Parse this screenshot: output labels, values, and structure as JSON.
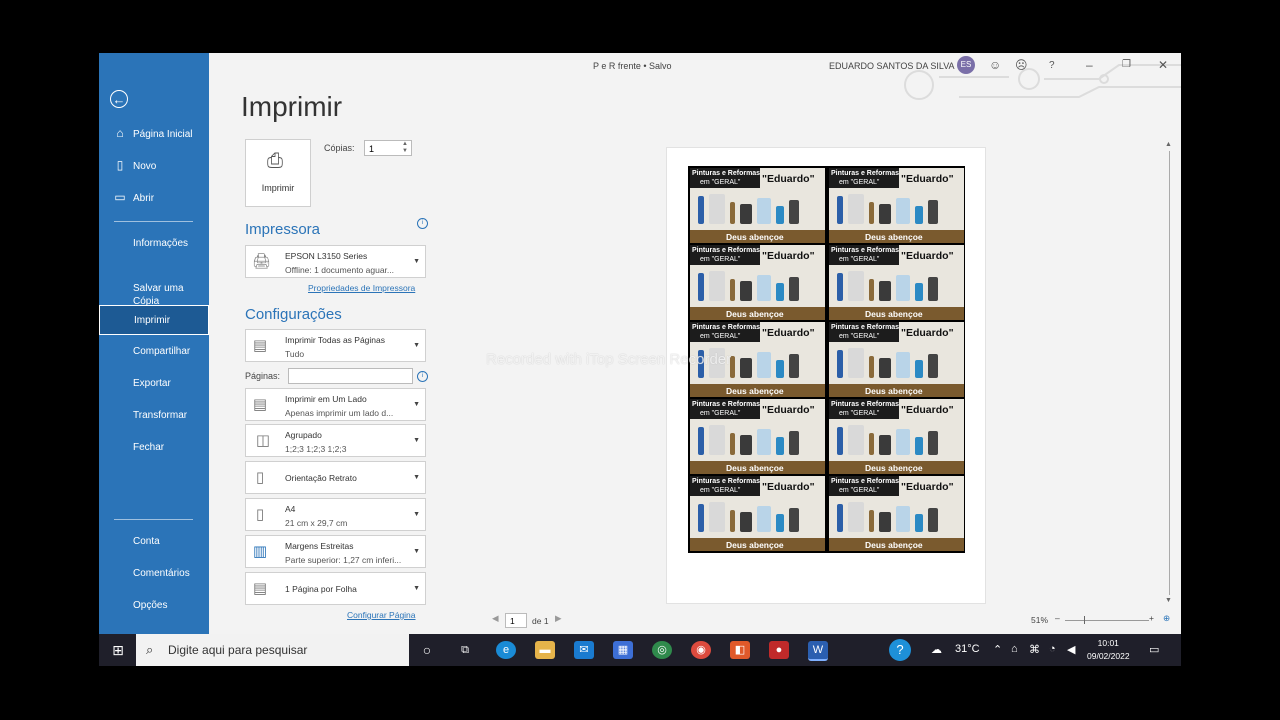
{
  "window": {
    "doc_title": "P e R  frente • Salvo",
    "user": "EDUARDO SANTOS DA SILVA",
    "avatar_initials": "ES"
  },
  "sidebar": {
    "items": [
      {
        "label": "Página Inicial",
        "icon": "home-icon"
      },
      {
        "label": "Novo",
        "icon": "new-document-icon"
      },
      {
        "label": "Abrir",
        "icon": "folder-open-icon"
      },
      {
        "label": "Informações"
      },
      {
        "label": "Salvar uma\nCópia"
      },
      {
        "label": "Imprimir"
      },
      {
        "label": "Compartilhar"
      },
      {
        "label": "Exportar"
      },
      {
        "label": "Transformar"
      },
      {
        "label": "Fechar"
      },
      {
        "label": "Conta"
      },
      {
        "label": "Comentários"
      },
      {
        "label": "Opções"
      }
    ]
  },
  "print": {
    "title": "Imprimir",
    "print_button": "Imprimir",
    "copies_label": "Cópias:",
    "copies_value": "1",
    "printer_heading": "Impressora",
    "printer_name": "EPSON L3150 Series",
    "printer_status": "Offline: 1 documento aguar...",
    "printer_properties": "Propriedades de Impressora",
    "settings_heading": "Configurações",
    "pages_label": "Páginas:",
    "settings": [
      {
        "line1": "Imprimir Todas as Páginas",
        "line2": "Tudo"
      },
      {
        "line1": "Imprimir em Um Lado",
        "line2": "Apenas imprimir um lado d..."
      },
      {
        "line1": "Agrupado",
        "line2": "1;2;3    1;2;3    1;2;3"
      },
      {
        "line1": "Orientação Retrato",
        "line2": ""
      },
      {
        "line1": "A4",
        "line2": "21 cm x 29,7 cm"
      },
      {
        "line1": "Margens Estreitas",
        "line2": "Parte superior: 1,27 cm inferi..."
      },
      {
        "line1": "1 Página por Folha",
        "line2": ""
      }
    ],
    "page_setup_link": "Configurar Página"
  },
  "preview": {
    "card_line1": "Pinturas e Reformas",
    "card_line2": "em \"GERAL\"",
    "card_name": "\"Eduardo\"",
    "card_blessing": "Deus abençoe",
    "card_count": 10,
    "watermark": "Recorded with iTop Screen Recorder",
    "page_current": "1",
    "page_of": "de 1",
    "zoom": "51%"
  },
  "taskbar": {
    "search_placeholder": "Digite aqui para pesquisar",
    "temperature": "31°C",
    "time": "10:01",
    "date": "09/02/2022"
  },
  "colors": {
    "accent": "#2b74b8",
    "sidebar_active": "#1d5a94",
    "taskbar": "#1f1f2a"
  }
}
